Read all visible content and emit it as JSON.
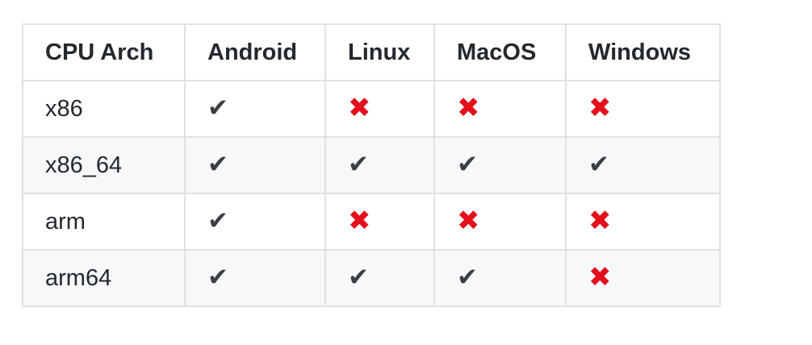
{
  "colors": {
    "cross": "#e3101b",
    "check": "#3b3f44",
    "border": "#dfe2e5",
    "stripe": "#f6f8fa"
  },
  "glyphs": {
    "yes": "✔",
    "no": "✖"
  },
  "table": {
    "headers": [
      "CPU Arch",
      "Android",
      "Linux",
      "MacOS",
      "Windows"
    ],
    "rows": [
      {
        "arch": "x86",
        "support": [
          "yes",
          "no",
          "no",
          "no"
        ]
      },
      {
        "arch": "x86_64",
        "support": [
          "yes",
          "yes",
          "yes",
          "yes"
        ]
      },
      {
        "arch": "arm",
        "support": [
          "yes",
          "no",
          "no",
          "no"
        ]
      },
      {
        "arch": "arm64",
        "support": [
          "yes",
          "yes",
          "yes",
          "no"
        ]
      }
    ]
  }
}
